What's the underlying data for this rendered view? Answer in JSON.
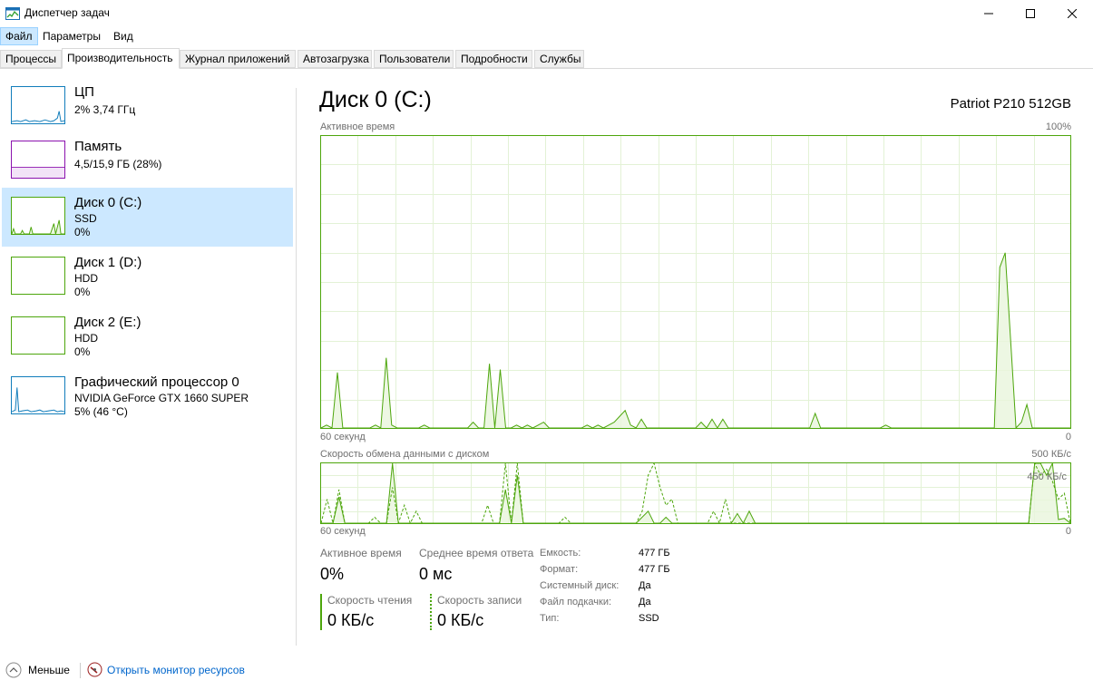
{
  "window": {
    "title": "Диспетчер задач"
  },
  "menu": [
    "Файл",
    "Параметры",
    "Вид"
  ],
  "tabs": [
    "Процессы",
    "Производительность",
    "Журнал приложений",
    "Автозагрузка",
    "Пользователи",
    "Подробности",
    "Службы"
  ],
  "sidebar": [
    {
      "name": "ЦП",
      "line1": "2% 3,74 ГГц",
      "line2": "",
      "color": "#117dbb"
    },
    {
      "name": "Память",
      "line1": "4,5/15,9 ГБ (28%)",
      "line2": "",
      "color": "#8b12ae"
    },
    {
      "name": "Диск 0 (C:)",
      "line1": "SSD",
      "line2": "0%",
      "color": "#4da60c"
    },
    {
      "name": "Диск 1 (D:)",
      "line1": "HDD",
      "line2": "0%",
      "color": "#4da60c"
    },
    {
      "name": "Диск 2 (E:)",
      "line1": "HDD",
      "line2": "0%",
      "color": "#4da60c"
    },
    {
      "name": "Графический процессор 0",
      "line1": "NVIDIA GeForce GTX 1660 SUPER",
      "line2": "5% (46 °C)",
      "color": "#117dbb"
    }
  ],
  "main": {
    "title": "Диск 0 (C:)",
    "model": "Patriot P210 512GB",
    "active_chart": {
      "label": "Активное время",
      "max": "100%",
      "time_left": "60 секунд",
      "time_right": "0"
    },
    "transfer_chart": {
      "label": "Скорость обмена данными с диском",
      "max": "500 КБ/с",
      "mid": "450 КБ/с",
      "time_left": "60 секунд",
      "time_right": "0"
    }
  },
  "chart_data": [
    {
      "type": "area",
      "title": "Активное время",
      "xlabel": "60 секунд",
      "ylim": [
        0,
        100
      ],
      "series": [
        {
          "values": [
            0,
            1,
            0,
            19,
            0,
            0,
            0,
            0,
            0,
            0,
            1,
            0,
            24,
            1,
            0,
            0,
            0,
            0,
            0,
            1,
            0,
            0,
            0,
            0,
            0,
            0,
            0,
            0,
            2,
            0,
            0,
            22,
            0,
            20,
            0,
            0,
            1,
            0,
            1,
            0,
            1,
            2,
            0,
            0,
            0,
            0,
            0,
            0,
            0,
            1,
            0,
            1,
            0,
            1,
            2,
            4,
            6,
            1,
            0,
            3,
            0,
            0,
            0,
            0,
            0,
            0,
            0,
            0,
            0,
            0,
            2,
            0,
            3,
            0,
            3,
            0,
            0,
            0,
            0,
            0,
            0,
            0,
            0,
            0,
            0,
            0,
            0,
            0,
            0,
            0,
            0,
            5,
            0,
            0,
            0,
            0,
            0,
            0,
            0,
            0,
            0,
            0,
            0,
            0,
            1,
            0,
            0,
            0,
            0,
            0,
            0,
            0,
            0,
            0,
            0,
            0,
            0,
            0,
            0,
            0,
            0,
            0,
            0,
            0,
            0,
            55,
            60,
            30,
            0,
            2,
            8,
            0,
            0,
            0,
            0,
            0,
            0,
            0,
            0
          ]
        }
      ]
    },
    {
      "type": "line",
      "title": "Скорость обмена данными с диском",
      "xlabel": "60 секунд",
      "ylim": [
        0,
        500
      ],
      "series": [
        {
          "name": "read",
          "values": [
            0,
            0,
            0,
            220,
            0,
            0,
            0,
            0,
            0,
            0,
            0,
            0,
            500,
            0,
            0,
            0,
            0,
            0,
            0,
            0,
            0,
            0,
            0,
            0,
            0,
            0,
            0,
            0,
            0,
            0,
            0,
            280,
            0,
            400,
            0,
            0,
            0,
            0,
            0,
            0,
            0,
            0,
            0,
            0,
            0,
            0,
            0,
            0,
            0,
            0,
            0,
            0,
            0,
            0,
            50,
            100,
            0,
            0,
            50,
            0,
            0,
            0,
            0,
            0,
            0,
            0,
            0,
            0,
            0,
            0,
            80,
            0,
            100,
            0,
            0,
            0,
            0,
            0,
            0,
            0,
            0,
            0,
            0,
            0,
            0,
            0,
            0,
            0,
            0,
            0,
            0,
            0,
            0,
            0,
            0,
            0,
            0,
            0,
            0,
            0,
            0,
            0,
            0,
            0,
            0,
            0,
            0,
            0,
            0,
            0,
            0,
            0,
            0,
            0,
            0,
            0,
            0,
            0,
            0,
            0,
            500,
            500,
            400,
            500,
            30,
            40,
            0
          ]
        },
        {
          "name": "write",
          "values": [
            0,
            200,
            0,
            280,
            0,
            0,
            0,
            0,
            0,
            50,
            0,
            0,
            300,
            0,
            150,
            0,
            100,
            0,
            0,
            0,
            0,
            0,
            0,
            0,
            0,
            0,
            0,
            0,
            150,
            0,
            0,
            500,
            0,
            500,
            0,
            0,
            0,
            0,
            0,
            0,
            0,
            50,
            0,
            0,
            0,
            0,
            0,
            0,
            0,
            0,
            0,
            0,
            0,
            0,
            100,
            400,
            500,
            300,
            150,
            200,
            0,
            0,
            0,
            0,
            0,
            0,
            100,
            0,
            200,
            0,
            0,
            0,
            0,
            0,
            0,
            0,
            0,
            0,
            0,
            0,
            0,
            0,
            0,
            0,
            0,
            0,
            0,
            0,
            0,
            0,
            0,
            0,
            0,
            0,
            0,
            0,
            0,
            0,
            0,
            0,
            0,
            0,
            0,
            0,
            0,
            0,
            0,
            0,
            0,
            0,
            0,
            0,
            0,
            0,
            0,
            0,
            0,
            0,
            0,
            0,
            500,
            400,
            450,
            350,
            200,
            250,
            0
          ]
        }
      ]
    }
  ],
  "stats": [
    {
      "label": "Активное время",
      "value": "0%"
    },
    {
      "label": "Среднее время ответа",
      "value": "0 мс"
    },
    {
      "label": "Скорость чтения",
      "value": "0 КБ/с"
    },
    {
      "label": "Скорость записи",
      "value": "0 КБ/с"
    }
  ],
  "props": [
    {
      "label": "Емкость:",
      "value": "477 ГБ"
    },
    {
      "label": "Формат:",
      "value": "477 ГБ"
    },
    {
      "label": "Системный диск:",
      "value": "Да"
    },
    {
      "label": "Файл подкачки:",
      "value": "Да"
    },
    {
      "label": "Тип:",
      "value": "SSD"
    }
  ],
  "footer": {
    "less": "Меньше",
    "monitor": "Открыть монитор ресурсов"
  }
}
